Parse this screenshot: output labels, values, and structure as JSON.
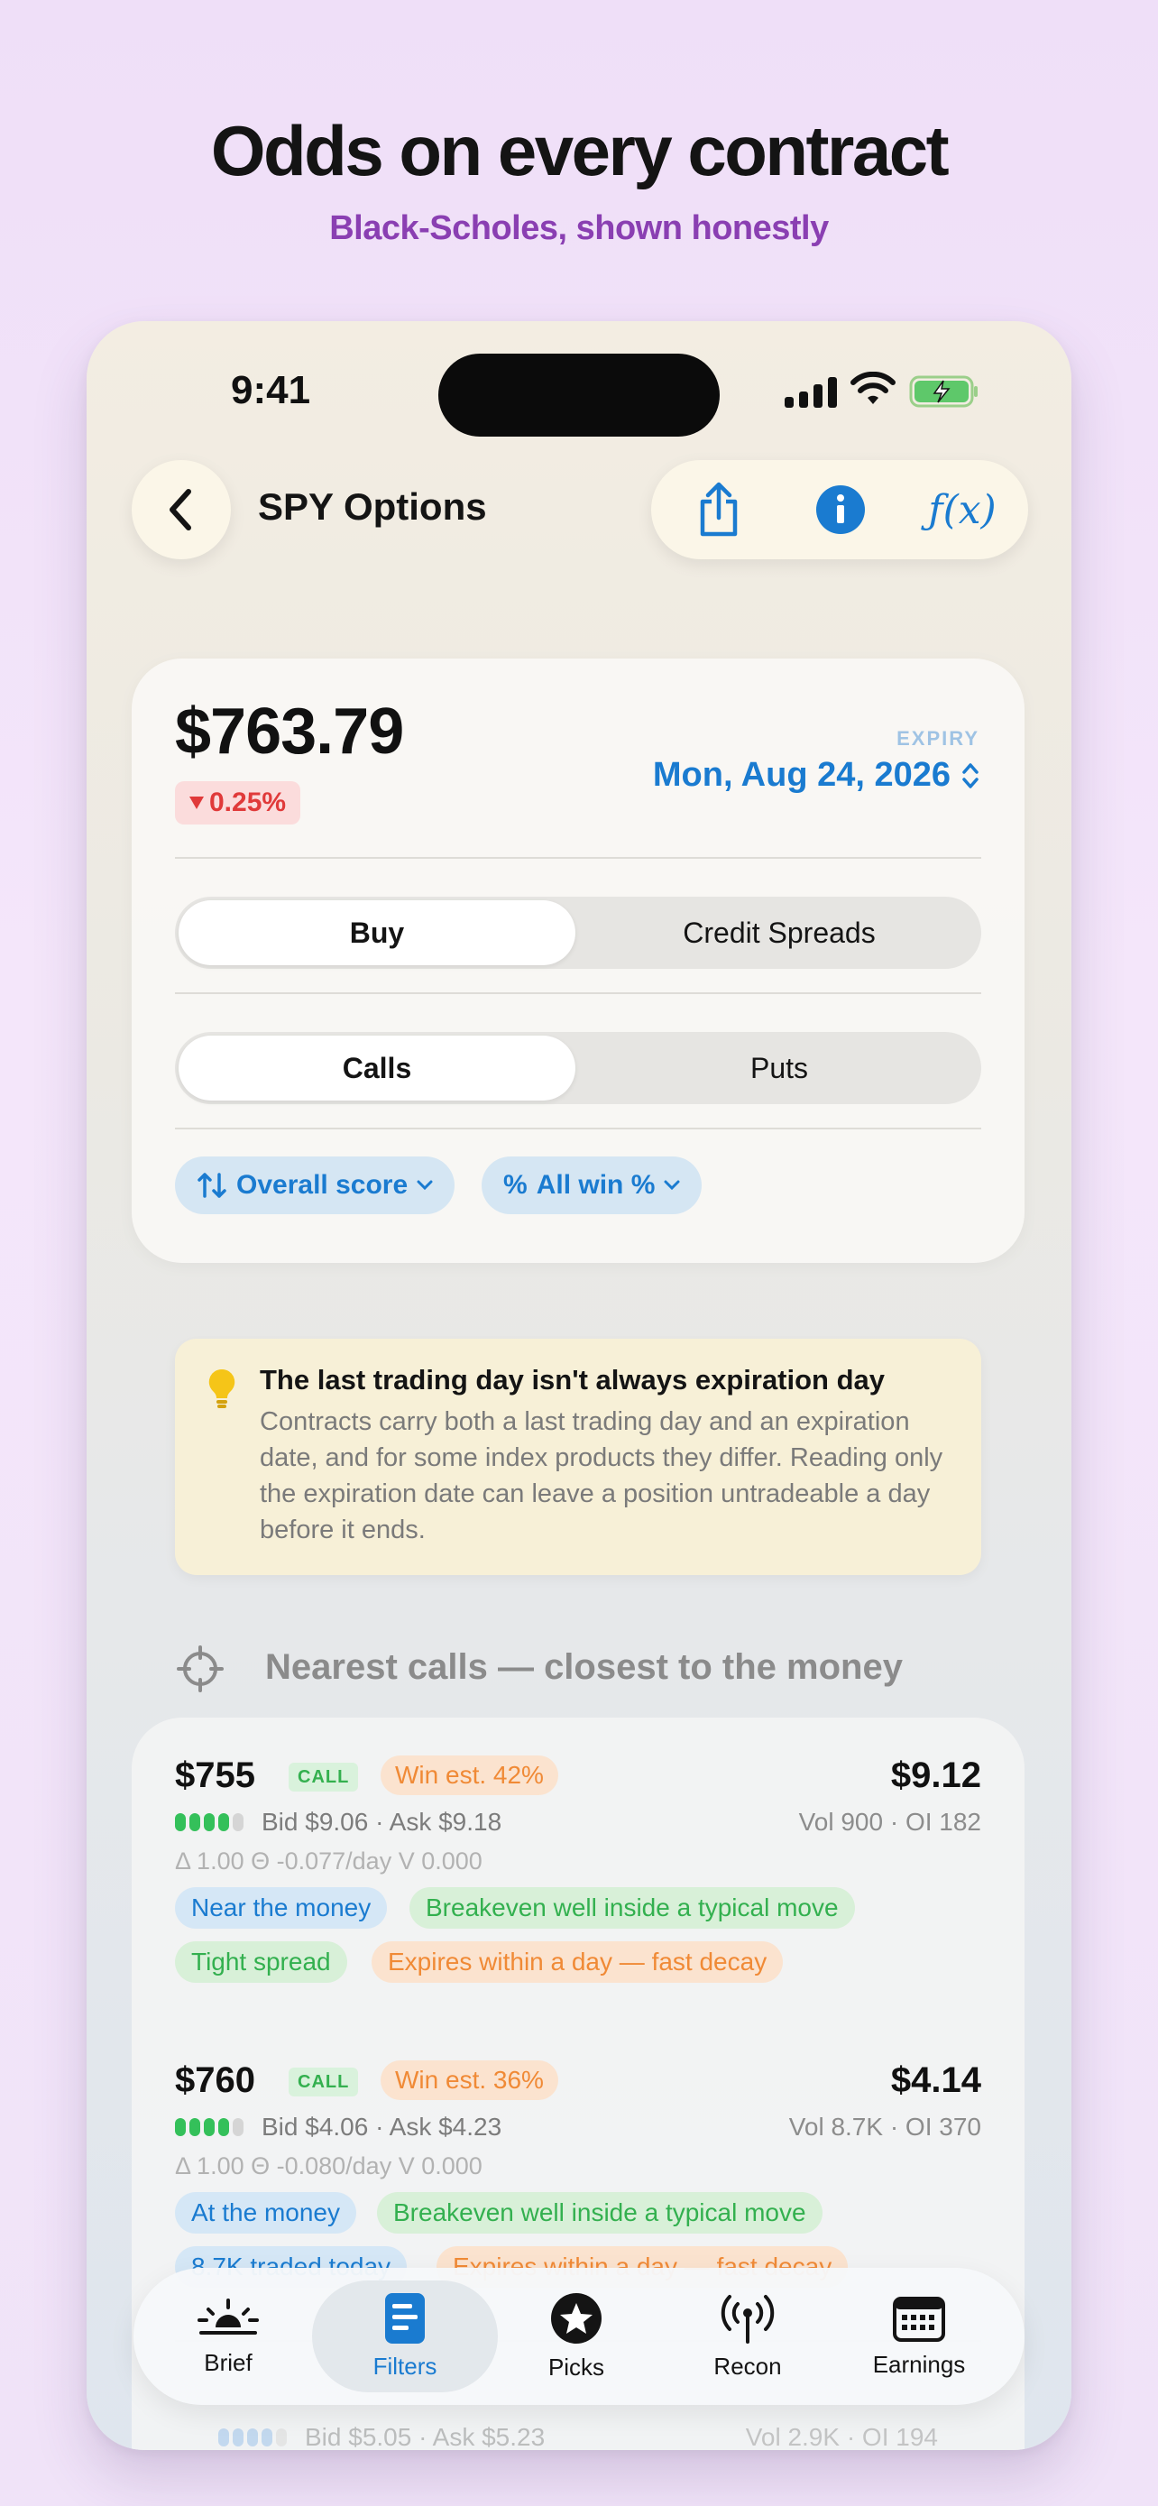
{
  "promo": {
    "headline": "Odds on every contract",
    "subline": "Black-Scholes, shown honestly"
  },
  "status_bar": {
    "time": "9:41"
  },
  "nav": {
    "title": "SPY Options",
    "actions": [
      "share-icon",
      "info-icon",
      "function-icon"
    ],
    "fx_label": "ƒ(x)"
  },
  "quote": {
    "price": "$763.79",
    "change": "0.25%",
    "change_direction": "down",
    "expiry_label": "EXPIRY",
    "expiry_value": "Mon, Aug 24, 2026"
  },
  "mode_segment": {
    "options": [
      "Buy",
      "Credit Spreads"
    ],
    "selected": "Buy"
  },
  "type_segment": {
    "options": [
      "Calls",
      "Puts"
    ],
    "selected": "Calls"
  },
  "filters": {
    "sort_label": "Overall score",
    "win_label": "All win %",
    "win_prefix": "%"
  },
  "tip": {
    "title": "The last trading day isn't always expiration day",
    "body": "Contracts carry both a last trading day and an expiration date, and for some index products they differ. Reading only the expiration date can leave a position untradeable a day before it ends."
  },
  "section": {
    "title": "Nearest calls — closest to the money"
  },
  "contracts": [
    {
      "strike": "$755",
      "type": "CALL",
      "win": "Win est. 42%",
      "mid": "$9.12",
      "liquidity_level": 4,
      "liquidity_max": 5,
      "bidask": "Bid $9.06 · Ask $9.18",
      "vol_oi": "Vol 900 · OI 182",
      "greeks": "Δ 1.00   Θ -0.077/day   V 0.000",
      "tags": [
        {
          "text": "Near the money",
          "color": "blue"
        },
        {
          "text": "Breakeven well inside a typical move",
          "color": "green"
        },
        {
          "text": "Tight spread",
          "color": "green"
        },
        {
          "text": "Expires within a day — fast decay",
          "color": "orange"
        }
      ]
    },
    {
      "strike": "$760",
      "type": "CALL",
      "win": "Win est. 36%",
      "mid": "$4.14",
      "liquidity_level": 4,
      "liquidity_max": 5,
      "bidask": "Bid $4.06 · Ask $4.23",
      "vol_oi": "Vol 8.7K · OI 370",
      "greeks": "Δ 1.00   Θ -0.080/day   V 0.000",
      "tags": [
        {
          "text": "At the money",
          "color": "blue"
        },
        {
          "text": "Breakeven well inside a typical move",
          "color": "green"
        },
        {
          "text": "8.7K traded today",
          "color": "blue"
        },
        {
          "text": "Expires within a day — fast decay",
          "color": "orange"
        }
      ]
    }
  ],
  "ghost_row": {
    "bidask": "Bid $5.05 · Ask $5.23",
    "vol_oi": "Vol 2.9K · OI 194"
  },
  "tabbar": {
    "tabs": [
      {
        "label": "Brief",
        "icon": "sunrise-icon"
      },
      {
        "label": "Filters",
        "icon": "filters-icon"
      },
      {
        "label": "Picks",
        "icon": "star-circle-icon"
      },
      {
        "label": "Recon",
        "icon": "antenna-icon"
      },
      {
        "label": "Earnings",
        "icon": "calendar-icon"
      }
    ],
    "active": "Filters"
  },
  "colors": {
    "accent": "#1a7bd0",
    "down": "#e03a3a",
    "green": "#34b04f",
    "orange": "#f08a36",
    "purple": "#8a3fb2"
  }
}
